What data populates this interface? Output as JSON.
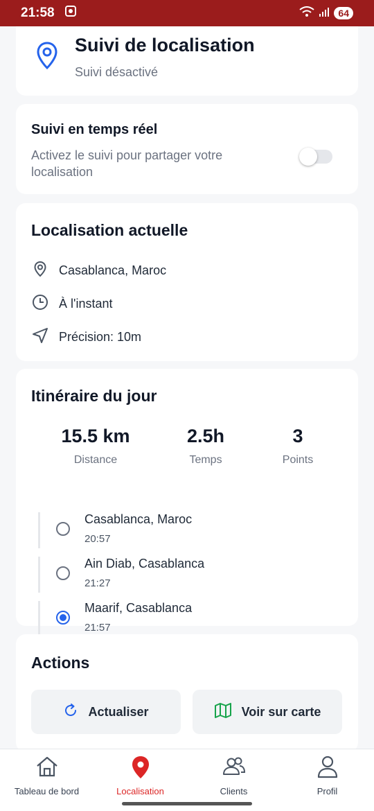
{
  "status_bar": {
    "time": "21:58",
    "battery": "64"
  },
  "header": {
    "title": "Suivi de localisation",
    "subtitle": "Suivi désactivé"
  },
  "realtime": {
    "title": "Suivi en temps réel",
    "description": "Activez le suivi pour partager votre localisation",
    "enabled": false
  },
  "current_location": {
    "title": "Localisation actuelle",
    "place": "Casablanca, Maroc",
    "time": "À l'instant",
    "precision": "Précision: 10m"
  },
  "itinerary": {
    "title": "Itinéraire du jour",
    "stats": [
      {
        "value": "15.5 km",
        "label": "Distance"
      },
      {
        "value": "2.5h",
        "label": "Temps"
      },
      {
        "value": "3",
        "label": "Points"
      }
    ],
    "stops": [
      {
        "name": "Casablanca, Maroc",
        "time": "20:57",
        "selected": false
      },
      {
        "name": "Ain Diab, Casablanca",
        "time": "21:27",
        "selected": false
      },
      {
        "name": "Maarif, Casablanca",
        "time": "21:57",
        "selected": true
      }
    ]
  },
  "actions": {
    "title": "Actions",
    "refresh_label": "Actualiser",
    "map_label": "Voir sur carte"
  },
  "nav": {
    "items": [
      {
        "label": "Tableau de bord",
        "icon": "home-icon"
      },
      {
        "label": "Localisation",
        "icon": "map-pin-icon",
        "active": true
      },
      {
        "label": "Clients",
        "icon": "users-icon"
      },
      {
        "label": "Profil",
        "icon": "user-icon"
      }
    ]
  },
  "colors": {
    "accent": "#dc2626",
    "status_bar": "#9b1c1c",
    "link_blue": "#2563eb",
    "map_green": "#16a34a"
  }
}
